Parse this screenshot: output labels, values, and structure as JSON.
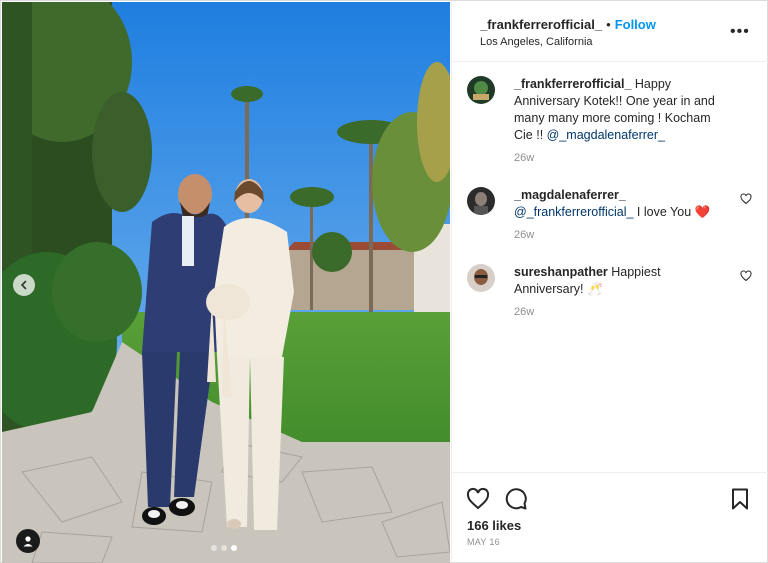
{
  "post": {
    "author": "_frankferrerofficial_",
    "separator": "•",
    "follow_label": "Follow",
    "location": "Los Angeles, California",
    "more_label": "•••",
    "likes": "166 likes",
    "date": "MAY 16"
  },
  "comments": [
    {
      "user": "_frankferrerofficial_",
      "text": " Happy Anniversary Kotek!! One year in and many many more coming ! Kocham Cie !! ",
      "mention": "@_magdalenaferrer_",
      "time": "26w"
    },
    {
      "user": "_magdalenaferrer_",
      "mention": "@_frankferrerofficial_",
      "text": " I love You ",
      "emoji": "❤️",
      "time": "26w"
    },
    {
      "user": "sureshanpather",
      "text": " Happiest Anniversary! ",
      "emoji": "🥂",
      "time": "26w"
    }
  ],
  "icons": {
    "prev": "chevron-left-icon",
    "tag": "user-tag-icon",
    "more": "more-options-icon",
    "like": "heart-icon",
    "comment": "comment-icon",
    "save": "bookmark-icon"
  },
  "colors": {
    "link_blue": "#0095f6",
    "mention": "#00376b",
    "heart_red": "#ed4956"
  }
}
